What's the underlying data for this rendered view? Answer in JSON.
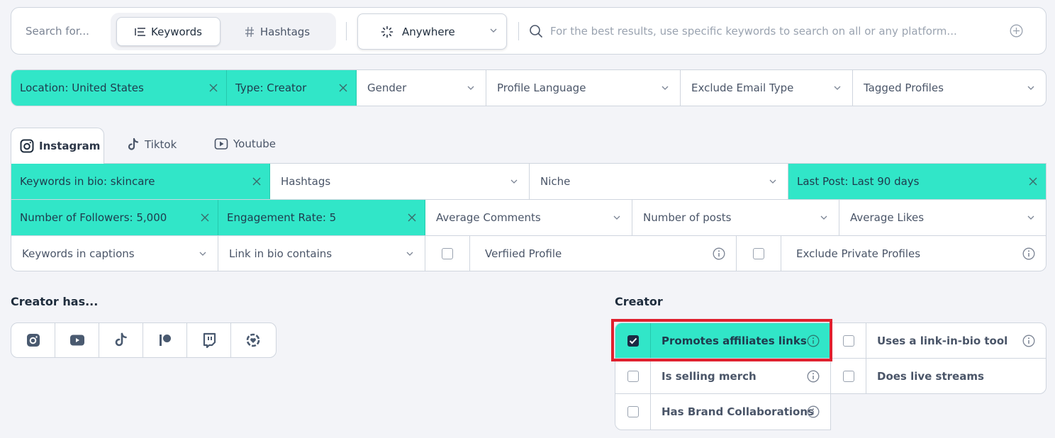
{
  "search": {
    "label": "Search for...",
    "modes": [
      {
        "label": "Keywords",
        "icon": "list-icon",
        "active": true
      },
      {
        "label": "Hashtags",
        "icon": "hash-icon",
        "active": false
      }
    ],
    "scope": {
      "label": "Anywhere",
      "icon": "spinner-icon"
    },
    "placeholder": "For the best results, use specific keywords to search on all or any platform...",
    "value": ""
  },
  "general_filters": [
    {
      "label": "Location: United States",
      "active": true
    },
    {
      "label": "Type: Creator",
      "active": true
    },
    {
      "label": "Gender",
      "active": false
    },
    {
      "label": "Profile Language",
      "active": false
    },
    {
      "label": "Exclude Email Type",
      "active": false
    },
    {
      "label": "Tagged Profiles",
      "active": false
    }
  ],
  "platform_tabs": [
    {
      "label": "Instagram",
      "icon": "instagram-icon",
      "active": true
    },
    {
      "label": "Tiktok",
      "icon": "tiktok-icon",
      "active": false
    },
    {
      "label": "Youtube",
      "icon": "youtube-icon",
      "active": false
    }
  ],
  "platform_filters": {
    "row1": [
      {
        "label": "Keywords in bio: skincare",
        "active": true
      },
      {
        "label": "Hashtags",
        "active": false
      },
      {
        "label": "Niche",
        "active": false
      },
      {
        "label": "Last Post: Last 90 days",
        "active": true
      }
    ],
    "row2": [
      {
        "label": "Number of Followers: 5,000",
        "active": true
      },
      {
        "label": "Engagement Rate: 5",
        "active": true
      },
      {
        "label": "Average Comments",
        "active": false
      },
      {
        "label": "Number of posts",
        "active": false
      },
      {
        "label": "Average Likes",
        "active": false
      }
    ],
    "row3": [
      {
        "label": "Keywords in captions",
        "type": "dropdown"
      },
      {
        "label": "Link in bio contains",
        "type": "dropdown"
      },
      {
        "label": "Verfiied Profile",
        "type": "checkbox",
        "checked": false
      },
      {
        "label": "Exclude Private Profiles",
        "type": "checkbox",
        "checked": false
      }
    ]
  },
  "creator_has": {
    "title": "Creator has...",
    "platforms": [
      "instagram-icon",
      "youtube-icon",
      "tiktok-icon",
      "patreon-icon",
      "twitch-icon",
      "onlyfans-icon"
    ]
  },
  "creator": {
    "title": "Creator",
    "options": [
      {
        "label": "Promotes affiliates links",
        "checked": true,
        "info": true
      },
      {
        "label": "Uses a link-in-bio tool",
        "checked": false,
        "info": true
      },
      {
        "label": "Is selling merch",
        "checked": false,
        "info": true
      },
      {
        "label": "Does live streams",
        "checked": false,
        "info": false
      },
      {
        "label": "Has Brand Collaborations",
        "checked": false,
        "info": true
      }
    ]
  },
  "colors": {
    "accent": "#31e6c8",
    "highlight": "#e0202e",
    "checkbox_checked": "#1b2a44",
    "background": "#f3f4f8"
  }
}
